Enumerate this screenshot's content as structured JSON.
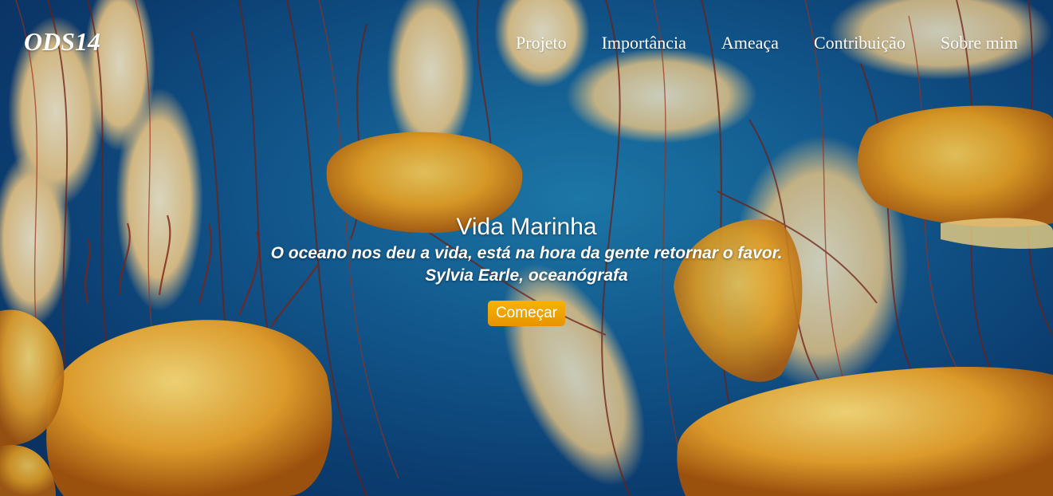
{
  "site": {
    "brand": "ODS14"
  },
  "nav": {
    "items": [
      {
        "label": "Projeto"
      },
      {
        "label": "Importância"
      },
      {
        "label": "Ameaça"
      },
      {
        "label": "Contribuição"
      },
      {
        "label": "Sobre mim"
      }
    ]
  },
  "hero": {
    "title": "Vida Marinha",
    "quote": "O oceano nos deu a vida, está na hora da gente retornar o favor.",
    "author": "Sylvia Earle, oceanógrafa",
    "cta_label": "Começar",
    "background_subject": "jellyfish-underwater",
    "colors": {
      "water": "#145e95",
      "jellyfish": "#f3a21c",
      "button": "#f0a800"
    }
  }
}
